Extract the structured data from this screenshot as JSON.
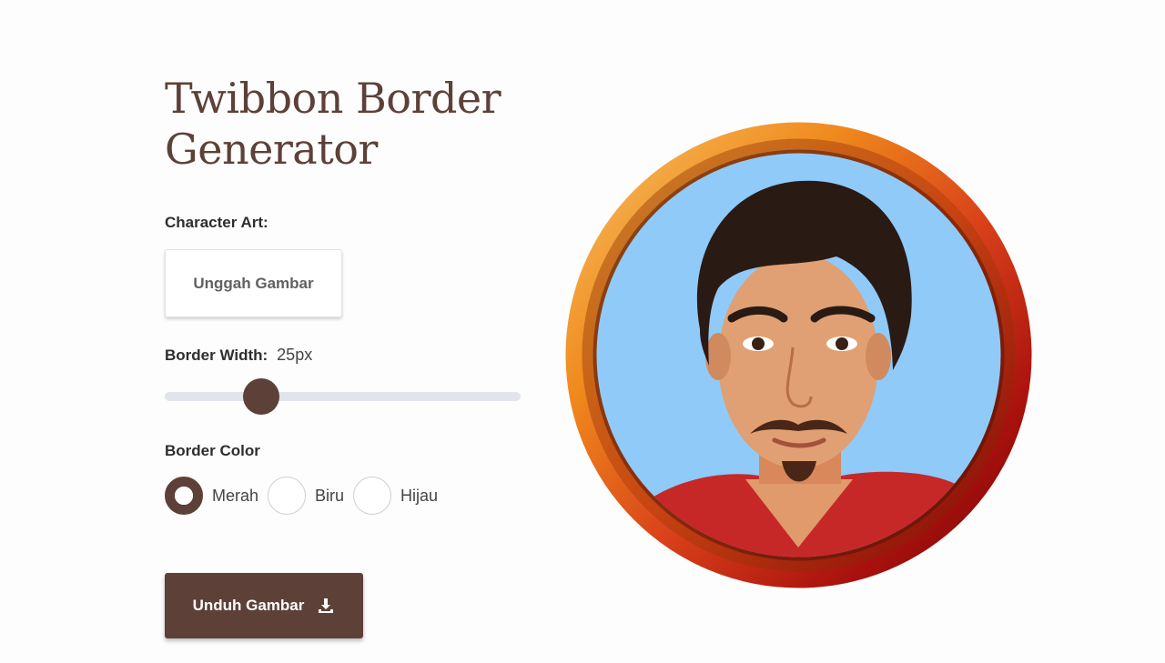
{
  "page": {
    "title": "Twibbon Border Generator"
  },
  "form": {
    "character_art_label": "Character Art:",
    "upload_label": "Unggah Gambar",
    "border_width_label": "Border Width:",
    "border_width_value": "25px",
    "border_width_slider_fraction": 0.27,
    "border_color_label": "Border Color",
    "color_options": [
      {
        "label": "Merah",
        "selected": true
      },
      {
        "label": "Biru",
        "selected": false
      },
      {
        "label": "Hijau",
        "selected": false
      }
    ],
    "download_label": "Unduh Gambar",
    "download_icon": "download-icon"
  },
  "theme": {
    "primary": "#5d4037",
    "track": "#e1e4ea",
    "border_gradient": [
      "#f7c469",
      "#f08a1c",
      "#d9421a",
      "#a8100d",
      "#6e0907"
    ],
    "preview_background": "#90caf9"
  }
}
